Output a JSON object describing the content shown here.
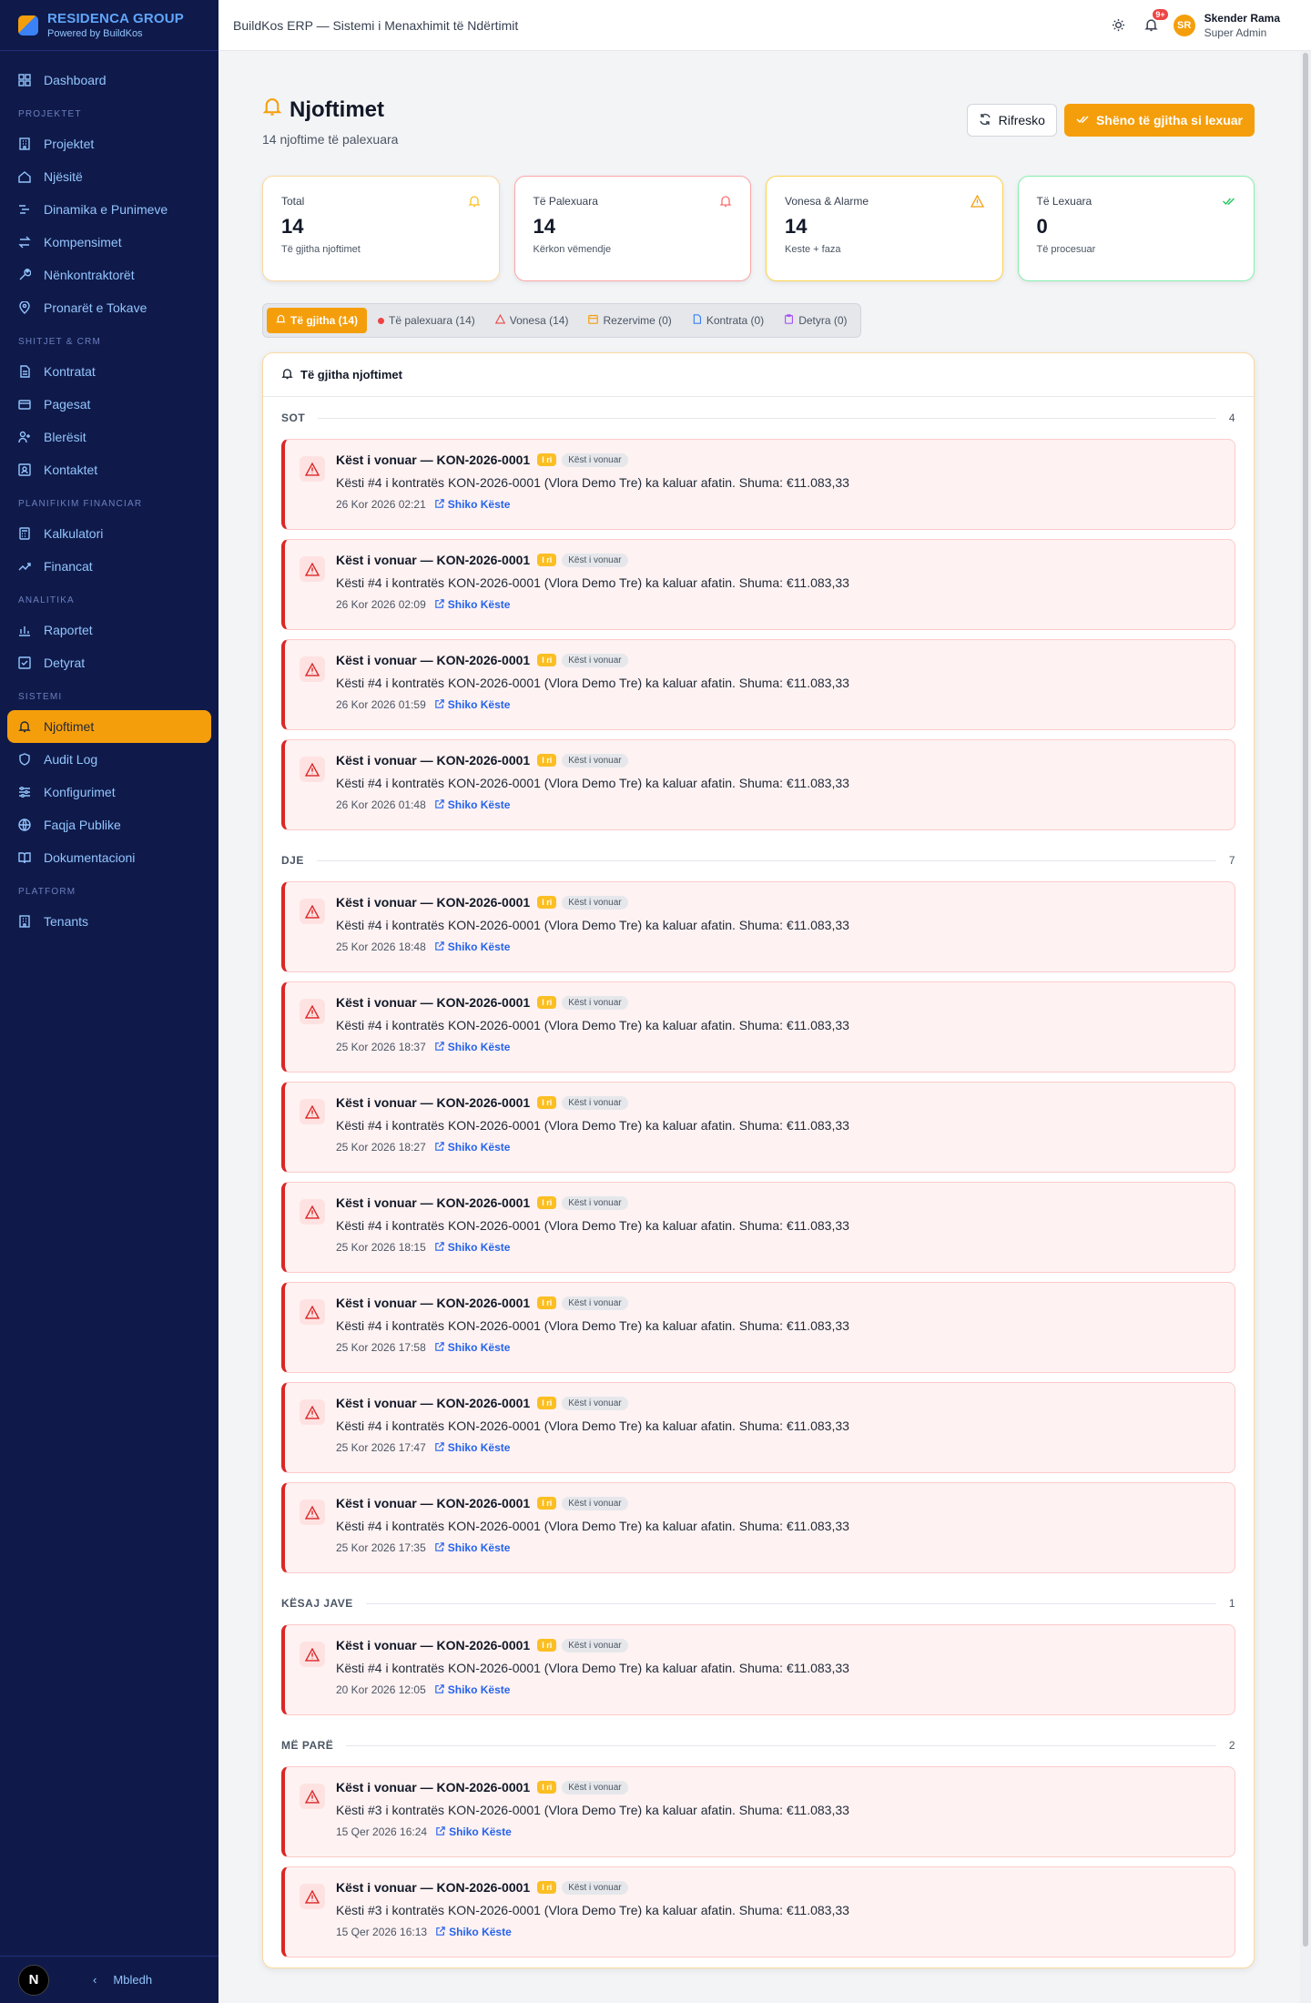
{
  "brand": {
    "name": "RESIDENCA GROUP",
    "sub": "Powered by BuildKos"
  },
  "sidebar": {
    "dashboard": "Dashboard",
    "sections": [
      {
        "title": "PROJEKTET",
        "items": [
          "Projektet",
          "Njësitë",
          "Dinamika e Punimeve",
          "Kompensimet",
          "Nënkontraktorët",
          "Pronarët e Tokave"
        ]
      },
      {
        "title": "SHITJET & CRM",
        "items": [
          "Kontratat",
          "Pagesat",
          "Blerësit",
          "Kontaktet"
        ]
      },
      {
        "title": "PLANIFIKIM FINANCIAR",
        "items": [
          "Kalkulatori",
          "Financat"
        ]
      },
      {
        "title": "ANALITIKA",
        "items": [
          "Raportet",
          "Detyrat"
        ]
      },
      {
        "title": "SISTEMI",
        "items": [
          "Njoftimet",
          "Audit Log",
          "Konfigurimet",
          "Faqja Publike",
          "Dokumentacioni"
        ]
      },
      {
        "title": "PLATFORM",
        "items": [
          "Tenants"
        ]
      }
    ],
    "footer": {
      "badge": "N",
      "collapse": "Mbledh"
    }
  },
  "topbar": {
    "title": "BuildKos ERP — Sistemi i Menaxhimit të Ndërtimit",
    "bell_badge": "9+",
    "user_initials": "SR",
    "user_name": "Skender Rama",
    "user_role": "Super Admin"
  },
  "page": {
    "title": "Njoftimet",
    "subtitle": "14 njoftime të palexuara",
    "refresh": "Rifresko",
    "mark_all": "Shëno të gjitha si lexuar"
  },
  "stats": [
    {
      "label": "Total",
      "value": "14",
      "sub": "Të gjitha njoftimet"
    },
    {
      "label": "Të Palexuara",
      "value": "14",
      "sub": "Kërkon vëmendje"
    },
    {
      "label": "Vonesa & Alarme",
      "value": "14",
      "sub": "Keste + faza"
    },
    {
      "label": "Të Lexuara",
      "value": "0",
      "sub": "Të procesuar"
    }
  ],
  "tabs": [
    "Të gjitha (14)",
    "Të palexuara (14)",
    "Vonesa (14)",
    "Rezervime (0)",
    "Kontrata (0)",
    "Detyra (0)"
  ],
  "panel": {
    "title": "Të gjitha njoftimet"
  },
  "common": {
    "title": "Këst i vonuar — KON-2026-0001",
    "new": "I ri",
    "tag": "Këst i vonuar",
    "link": "Shiko Këste"
  },
  "groups": [
    {
      "name": "SOT",
      "count": "4",
      "items": [
        {
          "msg": "Kësti #4 i kontratës KON-2026-0001 (Vlora Demo Tre) ka kaluar afatin. Shuma: €11.083,33",
          "time": "26 Kor 2026 02:21"
        },
        {
          "msg": "Kësti #4 i kontratës KON-2026-0001 (Vlora Demo Tre) ka kaluar afatin. Shuma: €11.083,33",
          "time": "26 Kor 2026 02:09"
        },
        {
          "msg": "Kësti #4 i kontratës KON-2026-0001 (Vlora Demo Tre) ka kaluar afatin. Shuma: €11.083,33",
          "time": "26 Kor 2026 01:59"
        },
        {
          "msg": "Kësti #4 i kontratës KON-2026-0001 (Vlora Demo Tre) ka kaluar afatin. Shuma: €11.083,33",
          "time": "26 Kor 2026 01:48"
        }
      ]
    },
    {
      "name": "DJE",
      "count": "7",
      "items": [
        {
          "msg": "Kësti #4 i kontratës KON-2026-0001 (Vlora Demo Tre) ka kaluar afatin. Shuma: €11.083,33",
          "time": "25 Kor 2026 18:48"
        },
        {
          "msg": "Kësti #4 i kontratës KON-2026-0001 (Vlora Demo Tre) ka kaluar afatin. Shuma: €11.083,33",
          "time": "25 Kor 2026 18:37"
        },
        {
          "msg": "Kësti #4 i kontratës KON-2026-0001 (Vlora Demo Tre) ka kaluar afatin. Shuma: €11.083,33",
          "time": "25 Kor 2026 18:27"
        },
        {
          "msg": "Kësti #4 i kontratës KON-2026-0001 (Vlora Demo Tre) ka kaluar afatin. Shuma: €11.083,33",
          "time": "25 Kor 2026 18:15"
        },
        {
          "msg": "Kësti #4 i kontratës KON-2026-0001 (Vlora Demo Tre) ka kaluar afatin. Shuma: €11.083,33",
          "time": "25 Kor 2026 17:58"
        },
        {
          "msg": "Kësti #4 i kontratës KON-2026-0001 (Vlora Demo Tre) ka kaluar afatin. Shuma: €11.083,33",
          "time": "25 Kor 2026 17:47"
        },
        {
          "msg": "Kësti #4 i kontratës KON-2026-0001 (Vlora Demo Tre) ka kaluar afatin. Shuma: €11.083,33",
          "time": "25 Kor 2026 17:35"
        }
      ]
    },
    {
      "name": "KËSAJ JAVE",
      "count": "1",
      "items": [
        {
          "msg": "Kësti #4 i kontratës KON-2026-0001 (Vlora Demo Tre) ka kaluar afatin. Shuma: €11.083,33",
          "time": "20 Kor 2026 12:05"
        }
      ]
    },
    {
      "name": "MË PARË",
      "count": "2",
      "items": [
        {
          "msg": "Kësti #3 i kontratës KON-2026-0001 (Vlora Demo Tre) ka kaluar afatin. Shuma: €11.083,33",
          "time": "15 Qer 2026 16:24"
        },
        {
          "msg": "Kësti #3 i kontratës KON-2026-0001 (Vlora Demo Tre) ka kaluar afatin. Shuma: €11.083,33",
          "time": "15 Qer 2026 16:13"
        }
      ]
    }
  ]
}
